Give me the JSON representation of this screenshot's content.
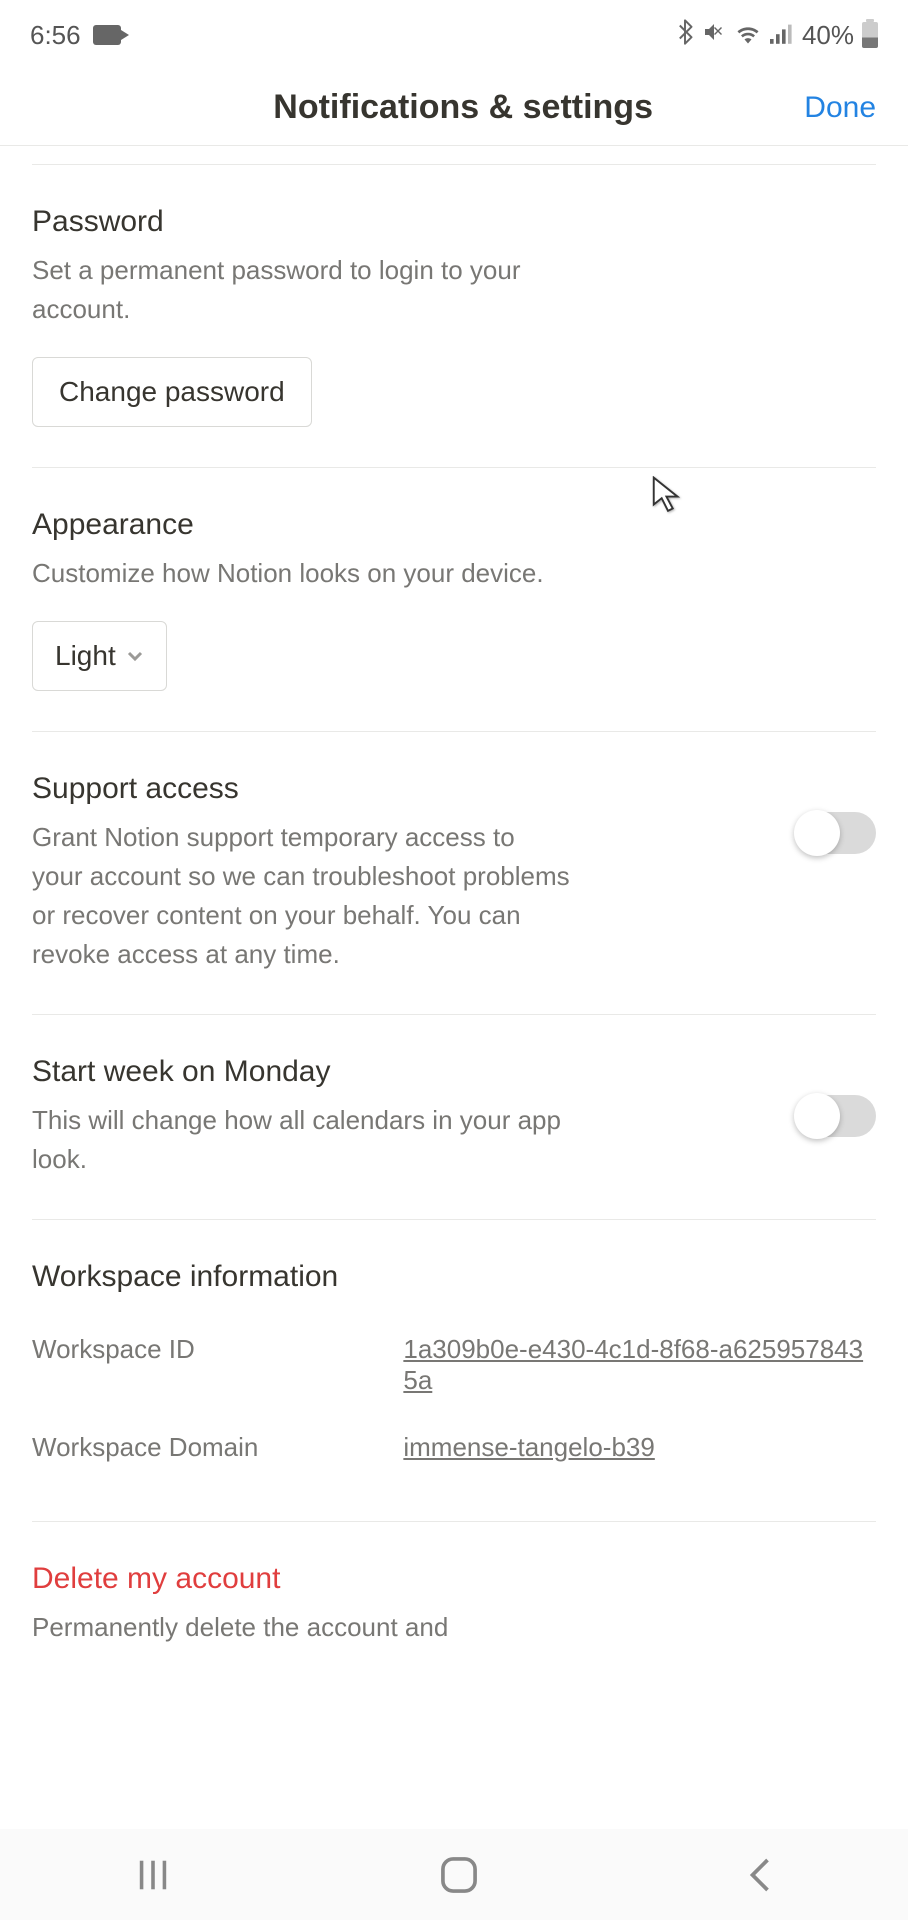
{
  "statusBar": {
    "time": "6:56",
    "batteryText": "40%"
  },
  "header": {
    "title": "Notifications & settings",
    "doneLabel": "Done"
  },
  "password": {
    "title": "Password",
    "desc": "Set a permanent password to login to your account.",
    "buttonLabel": "Change password"
  },
  "appearance": {
    "title": "Appearance",
    "desc": "Customize how Notion looks on your device.",
    "selectValue": "Light"
  },
  "supportAccess": {
    "title": "Support access",
    "desc": "Grant Notion support temporary access to your account so we can troubleshoot problems or recover content on your behalf. You can revoke access at any time.",
    "toggle": false
  },
  "startWeek": {
    "title": "Start week on Monday",
    "desc": "This will change how all calendars in your app look.",
    "toggle": false
  },
  "workspaceInfo": {
    "title": "Workspace information",
    "idLabel": "Workspace ID",
    "idValue": "1a309b0e-e430-4c1d-8f68-a6259578435a",
    "domainLabel": "Workspace Domain",
    "domainValue": "immense-tangelo-b39"
  },
  "deleteAccount": {
    "title": "Delete my account",
    "desc": "Permanently delete the account and"
  }
}
